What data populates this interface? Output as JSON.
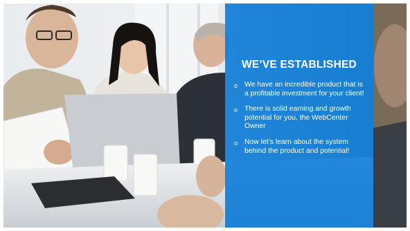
{
  "slide": {
    "title": "WE’VE ESTABLISHED",
    "bullets": [
      {
        "text": "We have an incredible product that is a profitable investment for your client!"
      },
      {
        "text": "There is solid earning and growth potential for you, the WebCenter Owner"
      },
      {
        "text": "Now let’s learn about the system behind the product and potential!"
      }
    ],
    "bullet_marker": "o"
  },
  "colors": {
    "panel": "#0076d6",
    "panel_text": "#ffffff"
  },
  "background_photo": {
    "description_icon": "business-meeting-photo"
  }
}
